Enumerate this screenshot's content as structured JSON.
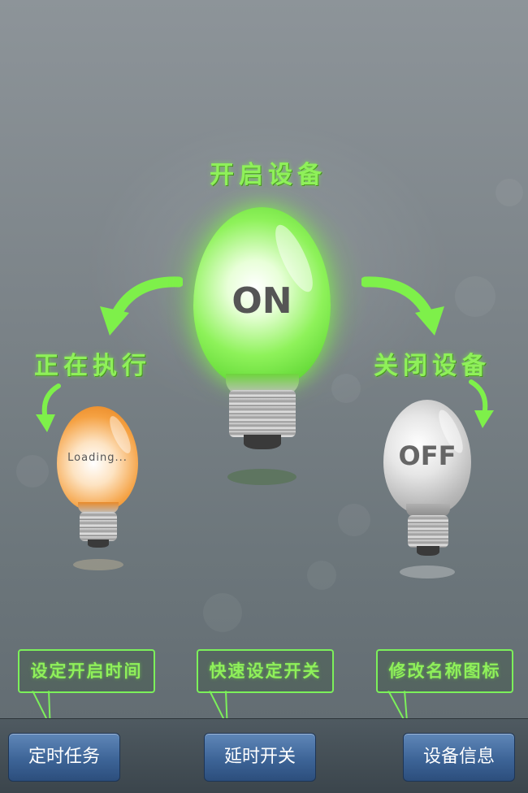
{
  "states": {
    "on_label": "开启设备",
    "executing_label": "正在执行",
    "off_label": "关闭设备"
  },
  "bulbs": {
    "on_text": "ON",
    "loading_text": "Loading...",
    "off_text": "OFF"
  },
  "callouts": {
    "schedule_time": "设定开启时间",
    "quick_switch": "快速设定开关",
    "rename_icon": "修改名称图标"
  },
  "toolbar": {
    "timer_tasks": "定时任务",
    "delay_switch": "延时开关",
    "device_info": "设备信息"
  },
  "colors": {
    "on_bulb": "#6ee03c",
    "loading_bulb": "#f5922a",
    "off_bulb": "#c8c8c8",
    "label_green": "#8ff05a",
    "button_blue": "#3d6497"
  }
}
